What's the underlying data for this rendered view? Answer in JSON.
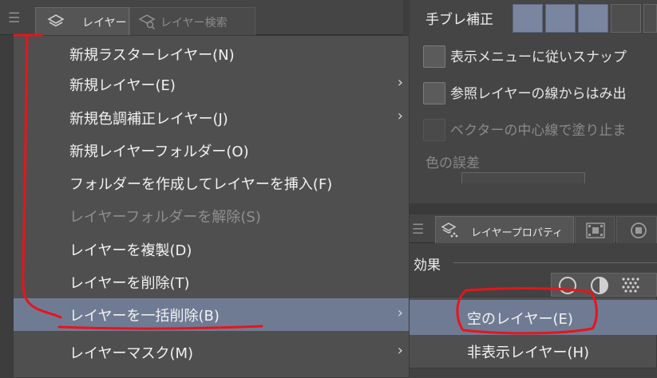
{
  "layer_panel": {
    "tabs": [
      {
        "label": "レイヤー",
        "icon": "layer-stack-icon"
      },
      {
        "label": "レイヤー検索",
        "icon": "layer-search-icon"
      }
    ]
  },
  "context_menu": {
    "items": [
      {
        "label": "新規ラスターレイヤー(N)",
        "has_submenu": false,
        "enabled": true
      },
      {
        "label": "新規レイヤー(E)",
        "has_submenu": true,
        "enabled": true
      },
      {
        "label": "新規色調補正レイヤー(J)",
        "has_submenu": true,
        "enabled": true
      },
      {
        "label": "新規レイヤーフォルダー(O)",
        "has_submenu": false,
        "enabled": true
      },
      {
        "label": "フォルダーを作成してレイヤーを挿入(F)",
        "has_submenu": false,
        "enabled": true
      },
      {
        "label": "レイヤーフォルダーを解除(S)",
        "has_submenu": false,
        "enabled": false
      },
      {
        "label": "レイヤーを複製(D)",
        "has_submenu": false,
        "enabled": true
      },
      {
        "label": "レイヤーを削除(T)",
        "has_submenu": false,
        "enabled": true
      },
      {
        "label": "レイヤーを一括削除(B)",
        "has_submenu": true,
        "enabled": true,
        "highlighted": true
      },
      {
        "label": "レイヤーマスク(M)",
        "has_submenu": true,
        "enabled": true
      }
    ],
    "arrow_glyph": "›"
  },
  "submenu": {
    "items": [
      {
        "label": "空のレイヤー(E)",
        "highlighted": true
      },
      {
        "label": "非表示レイヤー(H)",
        "highlighted": false
      }
    ]
  },
  "tool_settings": {
    "stabilization_label": "手ブレ補正",
    "options": [
      {
        "label": "表示メニューに従いスナップ",
        "checked": false,
        "enabled": true
      },
      {
        "label": "参照レイヤーの線からはみ出",
        "checked": false,
        "enabled": true
      },
      {
        "label": "ベクターの中心線で塗り止ま",
        "checked": false,
        "enabled": false
      }
    ],
    "color_error_label": "色の誤差"
  },
  "layer_property": {
    "tab_label": "レイヤープロパティ",
    "effect_label": "効果"
  },
  "colors": {
    "highlight": "#6f7b93",
    "menu_bg": "#4f4f4f",
    "annotation_red": "#e8141c"
  }
}
